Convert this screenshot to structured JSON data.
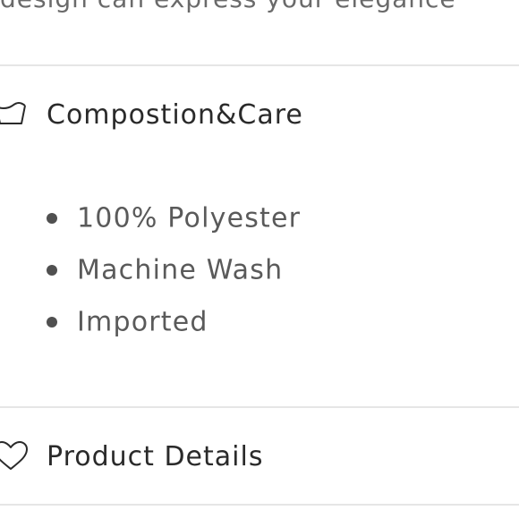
{
  "previous_section": {
    "cut_text": "design can express your elegance"
  },
  "sections": [
    {
      "title": "Compostion&Care",
      "icon": "wash-basin-icon",
      "items": [
        "100% Polyester",
        "Machine Wash",
        "Imported"
      ]
    },
    {
      "title": "Product Details",
      "icon": "heart-icon"
    }
  ]
}
